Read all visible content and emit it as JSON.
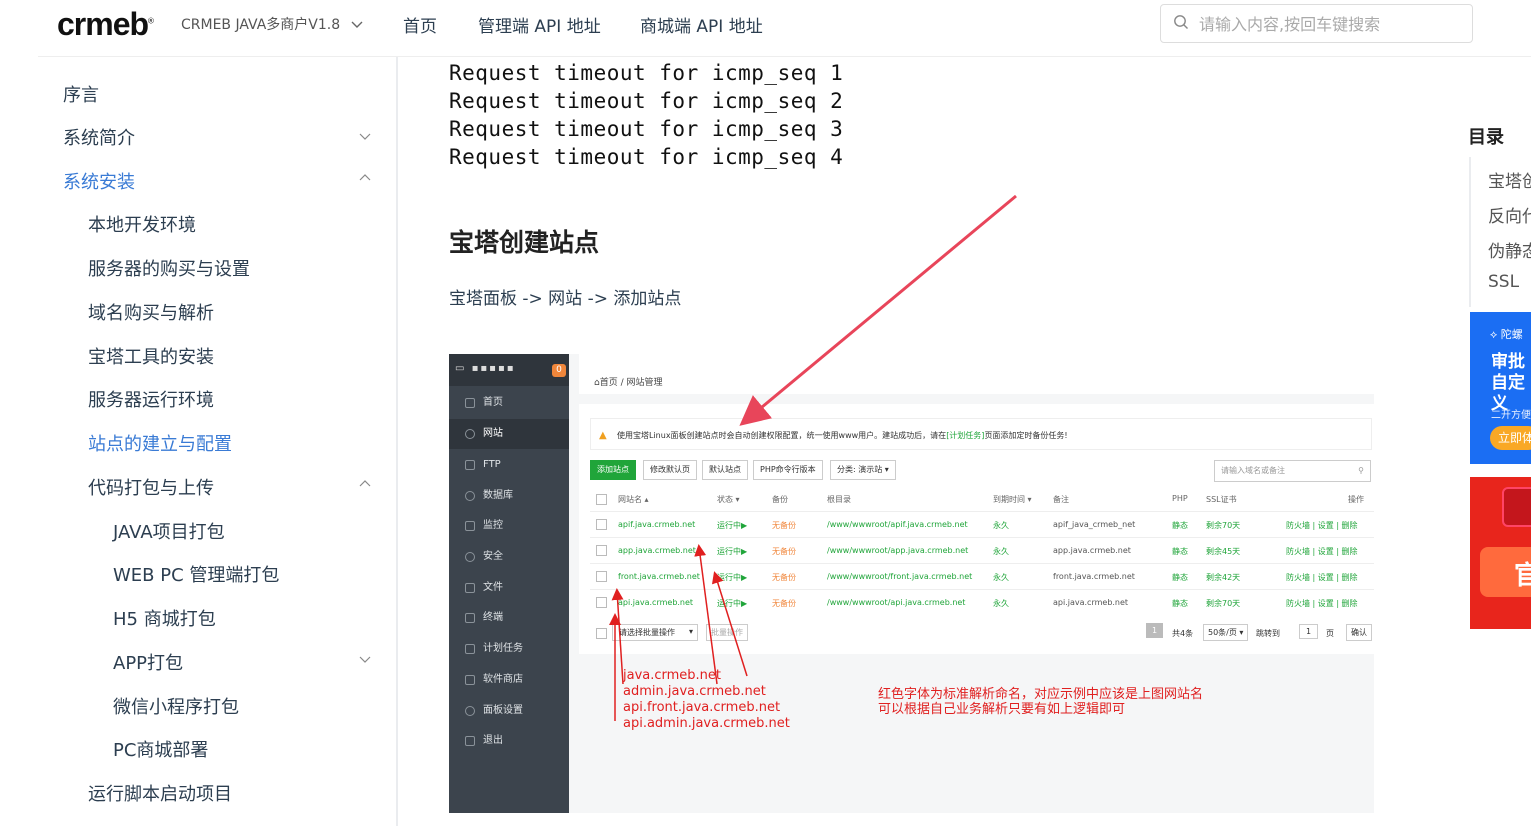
{
  "header": {
    "logo": "crmeb",
    "version": "CRMEB JAVA多商户V1.8",
    "nav": [
      "首页",
      "管理端 API 地址",
      "商城端 API 地址"
    ],
    "search_placeholder": "请输入内容,按回车键搜索"
  },
  "sidebar": {
    "items": [
      {
        "label": "序言"
      },
      {
        "label": "系统简介"
      },
      {
        "label": "系统安装"
      },
      {
        "label": "本地开发环境"
      },
      {
        "label": "服务器的购买与设置"
      },
      {
        "label": "域名购买与解析"
      },
      {
        "label": "宝塔工具的安装"
      },
      {
        "label": "服务器运行环境"
      },
      {
        "label": "站点的建立与配置"
      },
      {
        "label": "代码打包与上传"
      },
      {
        "label": "JAVA项目打包"
      },
      {
        "label": "WEB PC 管理端打包"
      },
      {
        "label": "H5 商城打包"
      },
      {
        "label": "APP打包"
      },
      {
        "label": "微信小程序打包"
      },
      {
        "label": "PC商城部署"
      },
      {
        "label": "运行脚本启动项目"
      }
    ]
  },
  "content": {
    "code_lines": [
      "Request timeout for icmp_seq 1",
      "Request timeout for icmp_seq 2",
      "Request timeout for icmp_seq 3",
      "Request timeout for icmp_seq 4"
    ],
    "heading": "宝塔创建站点",
    "breadcrumb": "宝塔面板 -> 网站 -> 添加站点"
  },
  "screenshot": {
    "badge": "0",
    "menu": [
      "首页",
      "网站",
      "FTP",
      "数据库",
      "监控",
      "安全",
      "文件",
      "终端",
      "计划任务",
      "软件商店",
      "面板设置",
      "退出"
    ],
    "crumb": "首页 / 网站管理",
    "warning_before": "使用宝塔Linux面板创建站点时会自动创建权限配置，统一使用www用户。建站成功后，请在",
    "warning_link": "[计划任务]",
    "warning_after": "页面添加定时备份任务!",
    "buttons": [
      "添加站点",
      "修改默认页",
      "默认站点",
      "PHP命令行版本",
      "分类: 演示站 ▾"
    ],
    "search_placeholder": "请输入域名或备注",
    "columns": [
      "网站名 ▴",
      "状态 ▾",
      "备份",
      "根目录",
      "到期时间 ▾",
      "备注",
      "PHP",
      "SSL证书",
      "操作"
    ],
    "rows": [
      {
        "name": "apif.java.crmeb.net",
        "status": "运行中▶",
        "backup": "无备份",
        "root": "/www/wwwroot/apif.java.crmeb.net",
        "expire": "永久",
        "note": "apif_java_crmeb_net",
        "php": "静态",
        "ssl": "剩余70天",
        "ops": "防火墙 | 设置 | 删除"
      },
      {
        "name": "app.java.crmeb.net",
        "status": "运行中▶",
        "backup": "无备份",
        "root": "/www/wwwroot/app.java.crmeb.net",
        "expire": "永久",
        "note": "app.java.crmeb.net",
        "php": "静态",
        "ssl": "剩余45天",
        "ops": "防火墙 | 设置 | 删除"
      },
      {
        "name": "front.java.crmeb.net",
        "status": "运行中▶",
        "backup": "无备份",
        "root": "/www/wwwroot/front.java.crmeb.net",
        "expire": "永久",
        "note": "front.java.crmeb.net",
        "php": "静态",
        "ssl": "剩余42天",
        "ops": "防火墙 | 设置 | 删除"
      },
      {
        "name": "api.java.crmeb.net",
        "status": "运行中▶",
        "backup": "无备份",
        "root": "/www/wwwroot/api.java.crmeb.net",
        "expire": "永久",
        "note": "api.java.crmeb.net",
        "php": "静态",
        "ssl": "剩余70天",
        "ops": "防火墙 | 设置 | 删除"
      }
    ],
    "batch_select": "请选择批量操作",
    "batch_btn": "批量操作",
    "pager": {
      "page": "1",
      "total": "共4条",
      "per_page": "50条/页",
      "jump": "跳转到",
      "jump_val": "1",
      "unit": "页",
      "confirm": "确认"
    },
    "annot_domains": [
      "java.crmeb.net",
      "admin.java.crmeb.net",
      "api.front.java.crmeb.net",
      "api.admin.java.crmeb.net"
    ],
    "annot_note": [
      "红色字体为标准解析命名，对应示例中应该是上图网站名",
      "可以根据自己业务解析只要有如上逻辑即可"
    ]
  },
  "toc": {
    "title": "目录",
    "items": [
      "宝塔创",
      "反向代",
      "伪静态",
      "SSL"
    ]
  },
  "ads": {
    "ad1_brand": "陀螺",
    "ad1_title": "审批自定义",
    "ad1_sub": "二开方便",
    "ad1_cta": "立即体",
    "ad2_text": "官"
  },
  "colors": {
    "link_active": "#3a7bd5",
    "bt_green": "#20a53a",
    "bt_sidebar": "#3c444d",
    "annotation_red": "#e02020"
  }
}
